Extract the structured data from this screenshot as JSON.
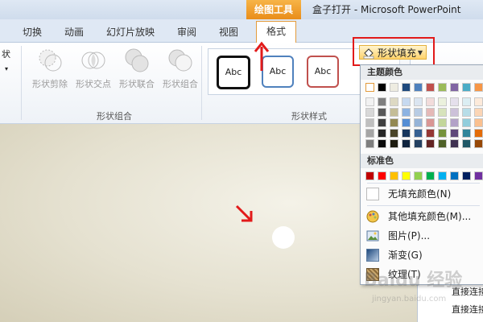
{
  "window": {
    "tool_group": "绘图工具",
    "title": "盒子打开 - Microsoft PowerPoint"
  },
  "tabs": [
    {
      "label": "切换"
    },
    {
      "label": "动画"
    },
    {
      "label": "幻灯片放映"
    },
    {
      "label": "审阅"
    },
    {
      "label": "视图"
    },
    {
      "label": "格式"
    }
  ],
  "ribbon": {
    "partial_left": [
      "状",
      "▾"
    ],
    "shape_combine": {
      "label": "形状组合",
      "buttons": [
        "形状剪除",
        "形状交点",
        "形状联合",
        "形状组合"
      ]
    },
    "shape_styles": {
      "label": "形状样式",
      "samples": [
        {
          "text": "Abc",
          "border": "#111111"
        },
        {
          "text": "Abc",
          "border": "#4f81bd"
        },
        {
          "text": "Abc",
          "border": "#c0504d"
        }
      ]
    },
    "fill_button": {
      "label": "形状填充",
      "highlight": "#e21a1a"
    }
  },
  "dropdown": {
    "theme_colors_label": "主题颜色",
    "theme_top_row": [
      "#ffffff",
      "#000000",
      "#eeece1",
      "#1f497d",
      "#4f81bd",
      "#c0504d",
      "#9bbb59",
      "#8064a2",
      "#4bacc6",
      "#f79646"
    ],
    "theme_shades": [
      [
        "#f2f2f2",
        "#7f7f7f",
        "#ddd9c3",
        "#c6d9f0",
        "#dbe5f1",
        "#f2dcdb",
        "#ebf1dd",
        "#e5e0ec",
        "#dbeef3",
        "#fdeada"
      ],
      [
        "#d8d8d8",
        "#595959",
        "#c4bd97",
        "#8db3e2",
        "#b8cce4",
        "#e5b9b7",
        "#d7e3bc",
        "#ccc1d9",
        "#b7dde8",
        "#fbd5b5"
      ],
      [
        "#bfbfbf",
        "#3f3f3f",
        "#938953",
        "#548dd4",
        "#95b3d7",
        "#d99694",
        "#c3d69b",
        "#b2a2c7",
        "#92cddc",
        "#fac08f"
      ],
      [
        "#a5a5a5",
        "#262626",
        "#494429",
        "#17365d",
        "#366092",
        "#953734",
        "#76923c",
        "#5f497a",
        "#31859b",
        "#e36c09"
      ],
      [
        "#7f7f7f",
        "#0c0c0c",
        "#1d1b10",
        "#0f243e",
        "#244061",
        "#632423",
        "#4f6128",
        "#3f3151",
        "#205867",
        "#974806"
      ]
    ],
    "standard_colors_label": "标准色",
    "standard_colors": [
      "#c00000",
      "#ff0000",
      "#ffc000",
      "#ffff00",
      "#92d050",
      "#00b050",
      "#00b0f0",
      "#0070c0",
      "#002060",
      "#7030a0"
    ],
    "items": [
      {
        "label": "无填充颜色(N)",
        "icon": "no-fill-icon"
      },
      {
        "label": "其他填充颜色(M)...",
        "icon": "palette-icon"
      },
      {
        "label": "图片(P)...",
        "icon": "picture-icon"
      },
      {
        "label": "渐变(G)",
        "icon": "gradient-icon"
      },
      {
        "label": "纹理(T)",
        "icon": "texture-icon"
      }
    ]
  },
  "behind_panel": {
    "lines": [
      "直接连接",
      "直接连接"
    ]
  },
  "watermark": {
    "text": "Baidu 经验",
    "sub": "jingyan.baidu.com"
  },
  "annotations": {
    "arrow_color": "#e21a1a"
  }
}
